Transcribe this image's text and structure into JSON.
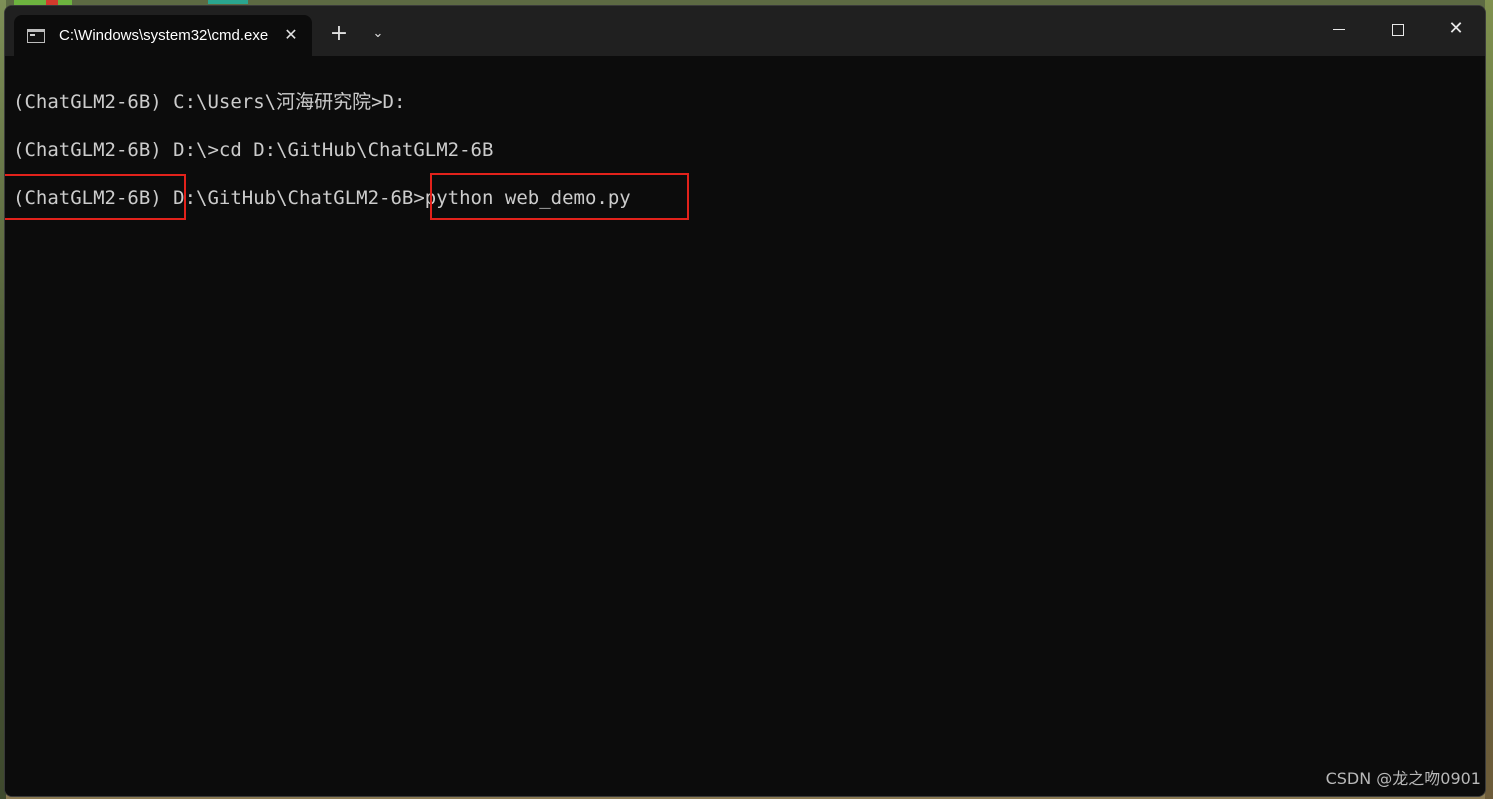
{
  "window": {
    "tab_title": "C:\\Windows\\system32\\cmd.exe",
    "tab_close_icon": "close-icon",
    "new_tab_label": "+",
    "dropdown_label": "⌄",
    "close_label": "✕"
  },
  "console": {
    "lines": [
      "(ChatGLM2-6B) C:\\Users\\河海研究院>D:",
      "(ChatGLM2-6B) D:\\>cd D:\\GitHub\\ChatGLM2-6B",
      "(ChatGLM2-6B) D:\\GitHub\\ChatGLM2-6B>python web_demo.py"
    ]
  },
  "annotations": {
    "box_color": "#e3221b"
  },
  "watermark": "CSDN @龙之吻0901"
}
